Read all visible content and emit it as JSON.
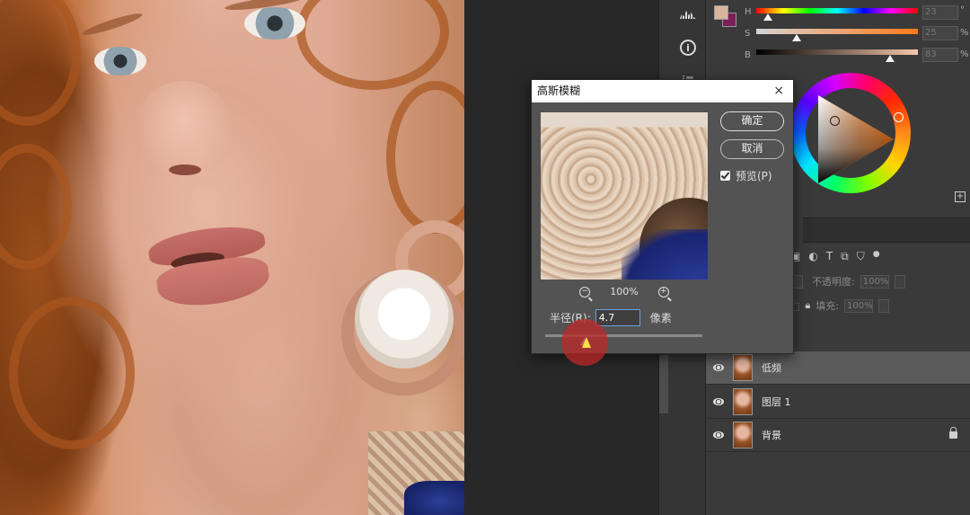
{
  "dialog": {
    "title": "高斯模糊",
    "close": "×",
    "ok_label": "确定",
    "cancel_label": "取消",
    "preview_label": "预览(P)",
    "preview_checked": true,
    "zoom_level": "100%",
    "zoom_out": "−",
    "zoom_in": "+",
    "radius_label": "半径(R):",
    "radius_value": "4.7",
    "radius_unit": "像素"
  },
  "color_panel": {
    "foreground": "#d7b49c",
    "background": "#7a1f57",
    "h_label": "H",
    "s_label": "S",
    "b_label": "B",
    "h_value": "23",
    "s_value": "25",
    "b_value": "83",
    "h_unit": "°",
    "s_unit": "%",
    "b_unit": "%"
  },
  "layers_panel": {
    "opacity_label": "不透明度:",
    "opacity_value": "100%",
    "fill_label": "填充:",
    "fill_value": "100%",
    "toolbar_icons": [
      "image-icon",
      "circle-half-icon",
      "type-icon",
      "transform-icon",
      "stamp-icon",
      "dot-icon"
    ],
    "layers": [
      {
        "name": "低频",
        "selected": true,
        "locked": false
      },
      {
        "name": "图层 1",
        "selected": false,
        "locked": false
      },
      {
        "name": "背景",
        "selected": false,
        "locked": true
      }
    ]
  },
  "tool_strip": {
    "icons": [
      "histogram-icon",
      "info-icon",
      "adjust-icon"
    ]
  }
}
